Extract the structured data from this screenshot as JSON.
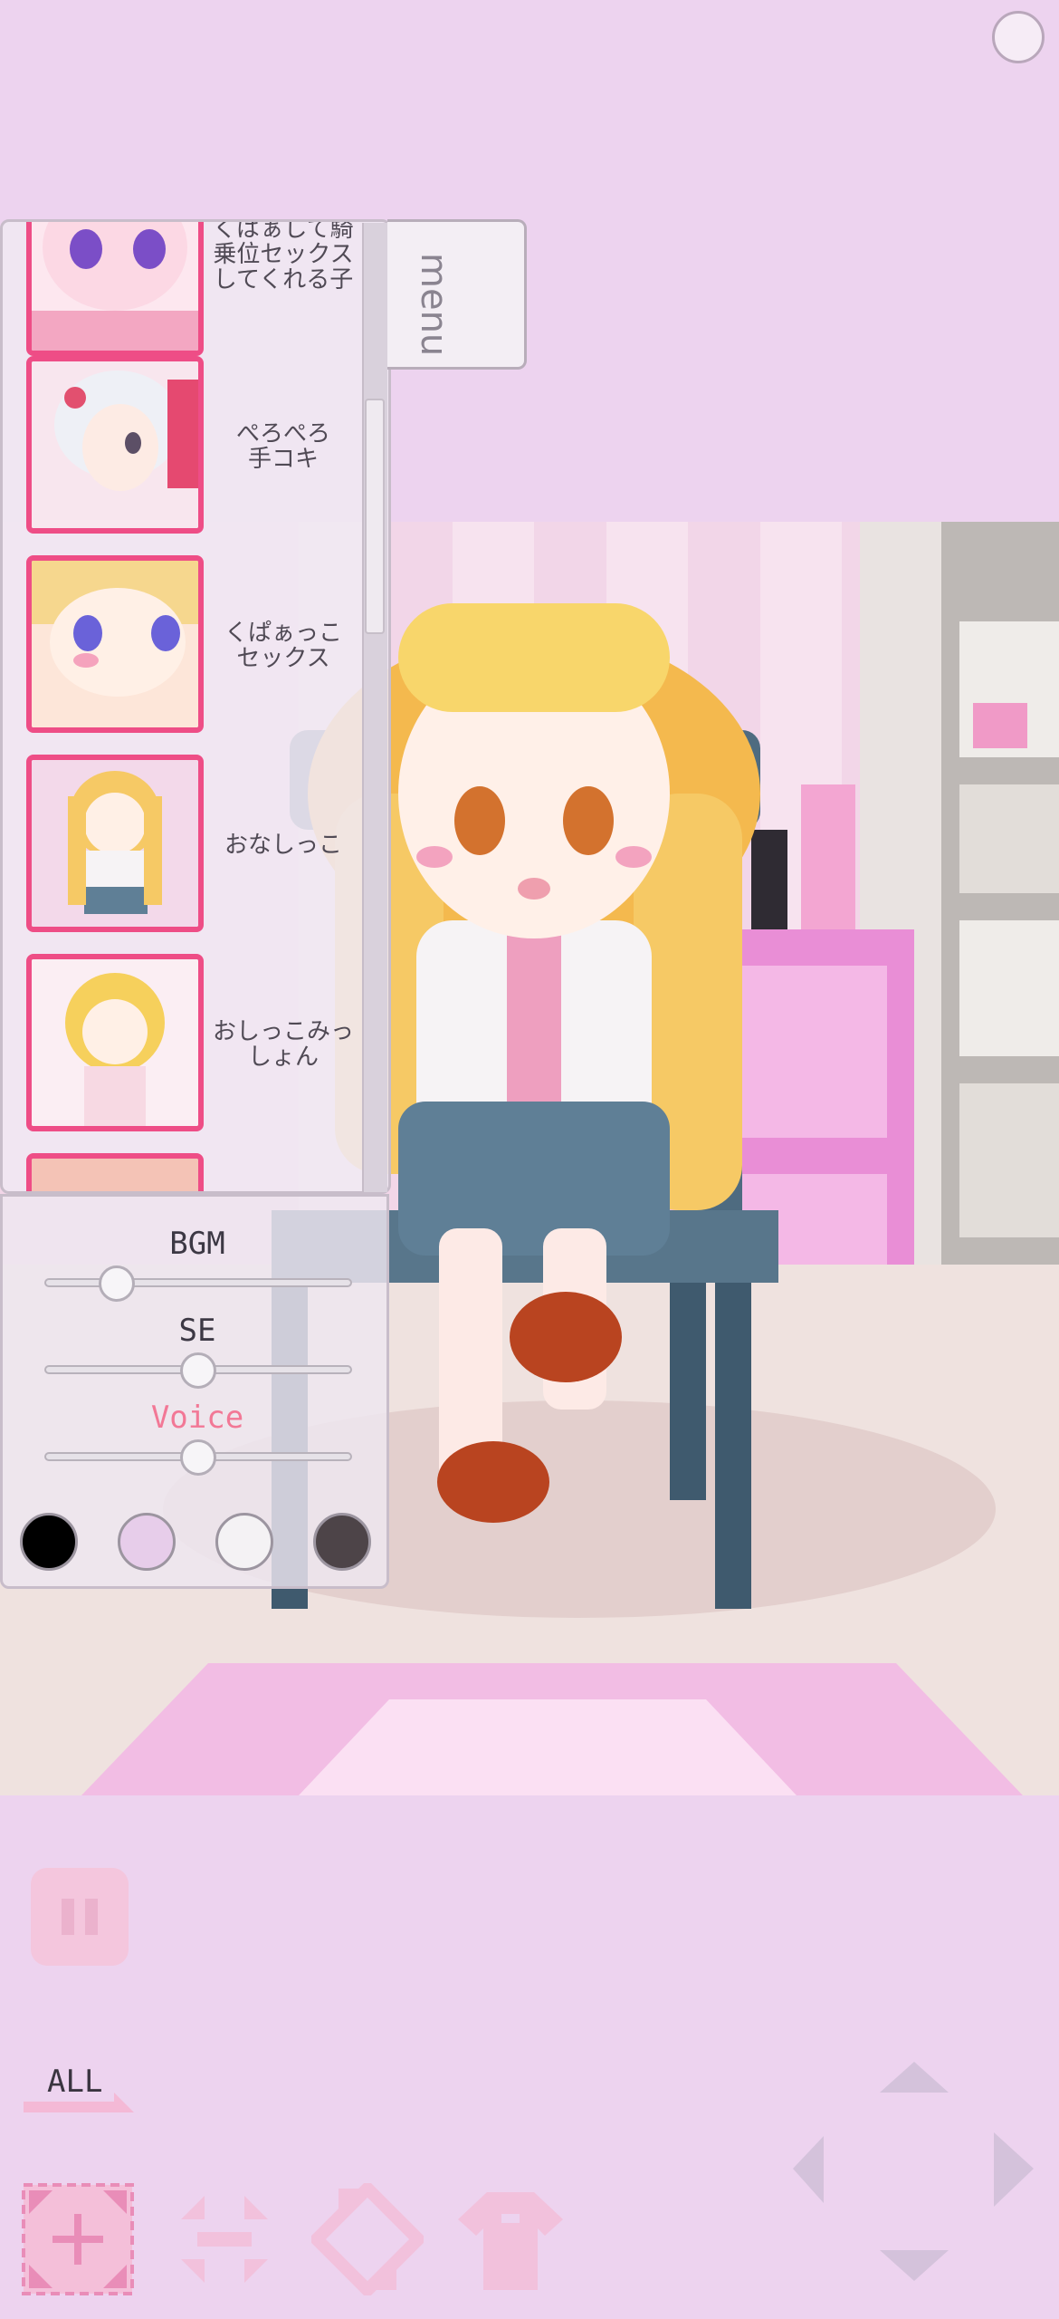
{
  "scene_list": {
    "items": [
      {
        "label": "くぱぁして騎\n乗位セックス\nしてくれる子",
        "thumb": "character-thumb-purple-eyes"
      },
      {
        "label": "ぺろぺろ\n手コキ",
        "thumb": "character-thumb-white-hair"
      },
      {
        "label": "くぱぁっこ\nセックス",
        "thumb": "character-thumb-blonde-closeup"
      },
      {
        "label": "おなしっこ",
        "thumb": "character-thumb-blonde-sitting"
      },
      {
        "label": "おしっこみっ\nしょん",
        "thumb": "character-thumb-blonde-standing"
      },
      {
        "label": "",
        "thumb": "character-thumb-partial"
      }
    ]
  },
  "menu_tab": {
    "label": "menu"
  },
  "audio": {
    "bgm_label": "BGM",
    "se_label": "SE",
    "voice_label": "Voice",
    "bgm_level": 0.15,
    "se_level": 0.5,
    "voice_level": 0.5
  },
  "background_swatches": [
    "#000000",
    "#e7cdea",
    "#f4f2f4",
    "#4d4448"
  ],
  "controls": {
    "all_label": "ALL",
    "tools": [
      "zoom-in-icon",
      "shrink-icon",
      "rotate-icon",
      "outfit-icon"
    ],
    "dpad": [
      "arrow-up-icon",
      "arrow-left-icon",
      "arrow-right-icon",
      "arrow-down-icon"
    ]
  },
  "colors": {
    "page_bg": "#edd3ef",
    "accent_pink": "#ee4d86",
    "hair_blonde": "#f8d66b",
    "chair_blue": "#4e6b80"
  }
}
